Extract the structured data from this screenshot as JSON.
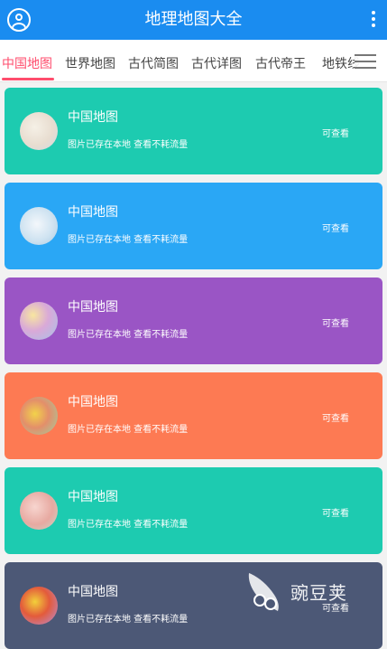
{
  "appbar": {
    "title": "地理地图大全",
    "user_icon": "user-circle-icon",
    "more_icon": "more-vertical-icon"
  },
  "tabs": [
    {
      "label": "中国地图",
      "active": true
    },
    {
      "label": "世界地图"
    },
    {
      "label": "古代简图"
    },
    {
      "label": "古代详图"
    },
    {
      "label": "古代帝王"
    },
    {
      "label": "地铁线"
    }
  ],
  "menu_icon": "menu-icon",
  "cards": [
    {
      "name": "中国地图",
      "desc": "图片已存在本地 查看不耗流量",
      "action": "可查看",
      "color": "#1dcbb0"
    },
    {
      "name": "中国地图",
      "desc": "图片已存在本地 查看不耗流量",
      "action": "可查看",
      "color": "#2aa7f5"
    },
    {
      "name": "中国地图",
      "desc": "图片已存在本地 查看不耗流量",
      "action": "可查看",
      "color": "#9a55c5"
    },
    {
      "name": "中国地图",
      "desc": "图片已存在本地 查看不耗流量",
      "action": "可查看",
      "color": "#fd7a53"
    },
    {
      "name": "中国地图",
      "desc": "图片已存在本地 查看不耗流量",
      "action": "可查看",
      "color": "#1dcbb0"
    },
    {
      "name": "中国地图",
      "desc": "图片已存在本地 查看不耗流量",
      "action": "可查看",
      "color": "#4c5876"
    }
  ],
  "watermark": {
    "text": "豌豆荚"
  }
}
